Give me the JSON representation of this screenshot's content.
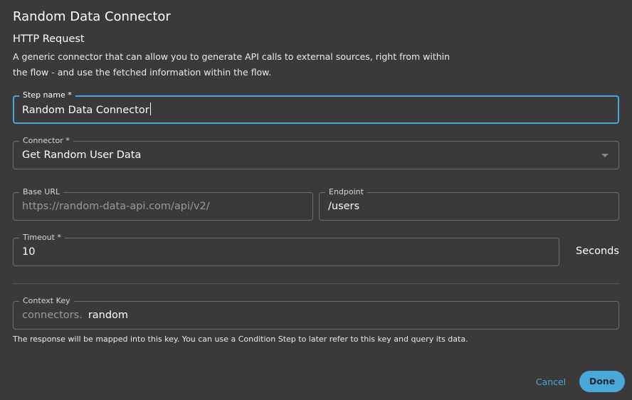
{
  "dialog": {
    "title": "Random Data Connector",
    "subtitle": "HTTP Request",
    "description": "A generic connector that can allow you to generate API calls to external sources, right from within the flow - and use the fetched information within the flow."
  },
  "step_name": {
    "label": "Step name *",
    "value": "Random Data Connector"
  },
  "connector": {
    "label": "Connector *",
    "value": "Get Random User Data"
  },
  "base_url": {
    "label": "Base URL",
    "value": "https://random-data-api.com/api/v2/"
  },
  "endpoint": {
    "label": "Endpoint",
    "value": "/users"
  },
  "timeout": {
    "label": "Timeout *",
    "value": "10",
    "unit": "Seconds"
  },
  "context_key": {
    "label": "Context Key",
    "prefix": "connectors.",
    "value": "random",
    "helper": "The response will be mapped into this key. You can use a Condition Step to later refer to this key and query its data."
  },
  "actions": {
    "cancel_label": "Cancel",
    "done_label": "Done"
  },
  "colors": {
    "background": "#3a3a3a",
    "accent": "#4aa8d8",
    "border": "#6e6e6e"
  },
  "icons": {
    "connector_dropdown": "chevron-down-icon"
  }
}
